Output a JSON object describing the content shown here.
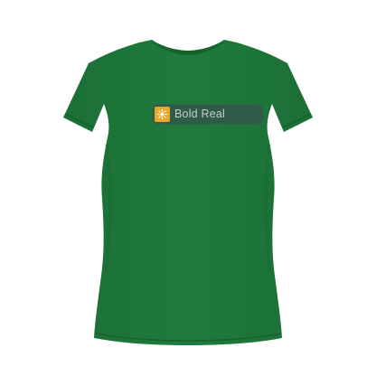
{
  "product": {
    "shirt_color": "#1f7a3c",
    "print": {
      "text": "Bold Real",
      "badge_color": "#2e5c46",
      "logo_color": "#e7a92b",
      "logo_icon": "sparkle-icon",
      "text_color": "#c7cdc9"
    }
  }
}
